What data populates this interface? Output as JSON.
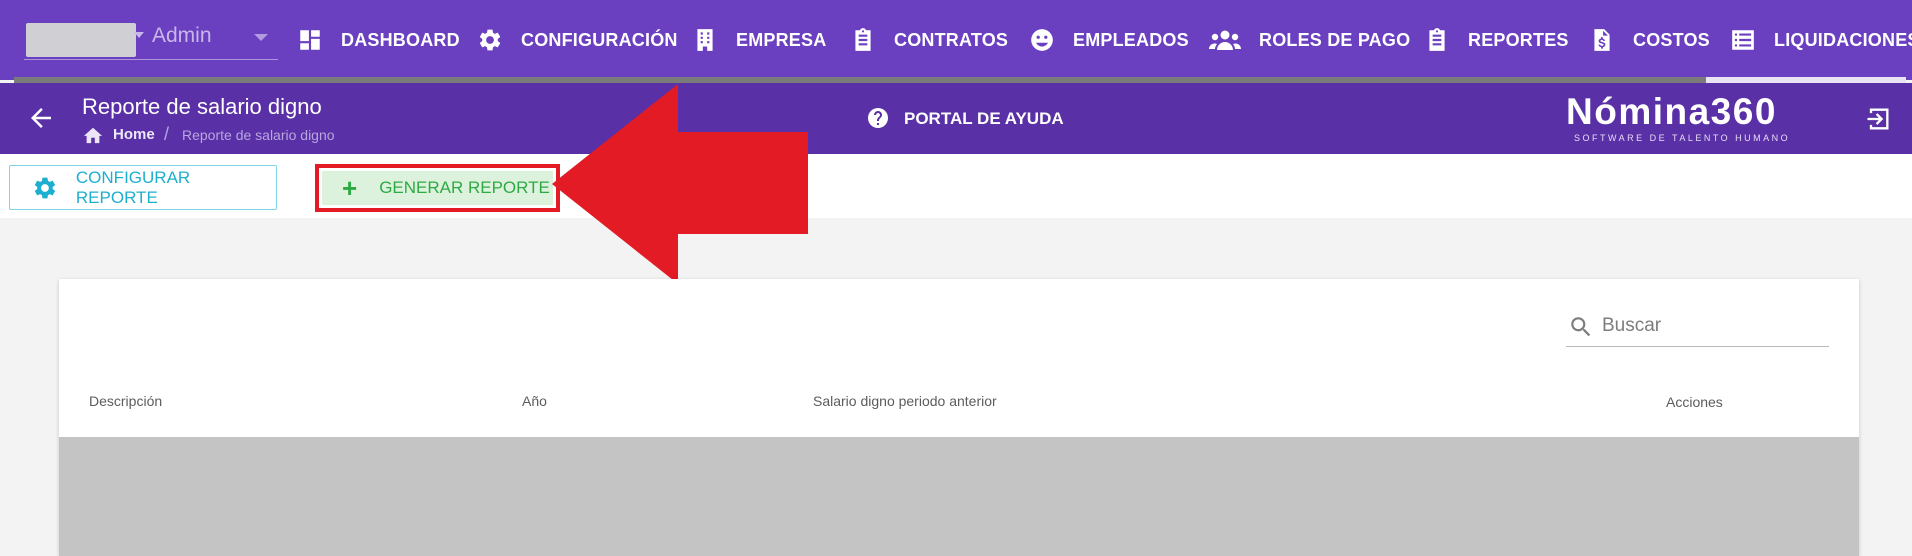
{
  "nav": {
    "user": {
      "role": "Admin"
    },
    "items": [
      {
        "label": "DASHBOARD",
        "icon": "dashboard-icon"
      },
      {
        "label": "CONFIGURACIÓN",
        "icon": "gear-icon"
      },
      {
        "label": "EMPRESA",
        "icon": "building-icon"
      },
      {
        "label": "CONTRATOS",
        "icon": "clipboard-icon"
      },
      {
        "label": "EMPLEADOS",
        "icon": "smiley-icon"
      },
      {
        "label": "ROLES DE PAGO",
        "icon": "users-icon"
      },
      {
        "label": "REPORTES",
        "icon": "clipboard-icon"
      },
      {
        "label": "COSTOS",
        "icon": "dollar-file-icon"
      },
      {
        "label": "LIQUIDACIONES",
        "icon": "list-icon"
      }
    ]
  },
  "header": {
    "title": "Reporte de salario digno",
    "breadcrumb": {
      "home": "Home",
      "separator": "/",
      "current": "Reporte de salario digno"
    },
    "help_label": "PORTAL DE AYUDA",
    "brand": {
      "name": "Nómina360",
      "tagline": "SOFTWARE DE TALENTO HUMANO"
    }
  },
  "toolbar": {
    "config_label": "CONFIGURAR REPORTE",
    "generate_label": "GENERAR REPORTE",
    "generate_icon": "+"
  },
  "table": {
    "search_placeholder": "Buscar",
    "columns": [
      "Descripción",
      "Año",
      "Salario digno periodo anterior",
      "Acciones"
    ],
    "rows": []
  },
  "colors": {
    "nav_bg": "#6a3fc0",
    "header_bg": "#5a30a6",
    "config_accent": "#1dafcf",
    "generate_accent": "#2eaa44",
    "annotation_red": "#e21b24"
  }
}
